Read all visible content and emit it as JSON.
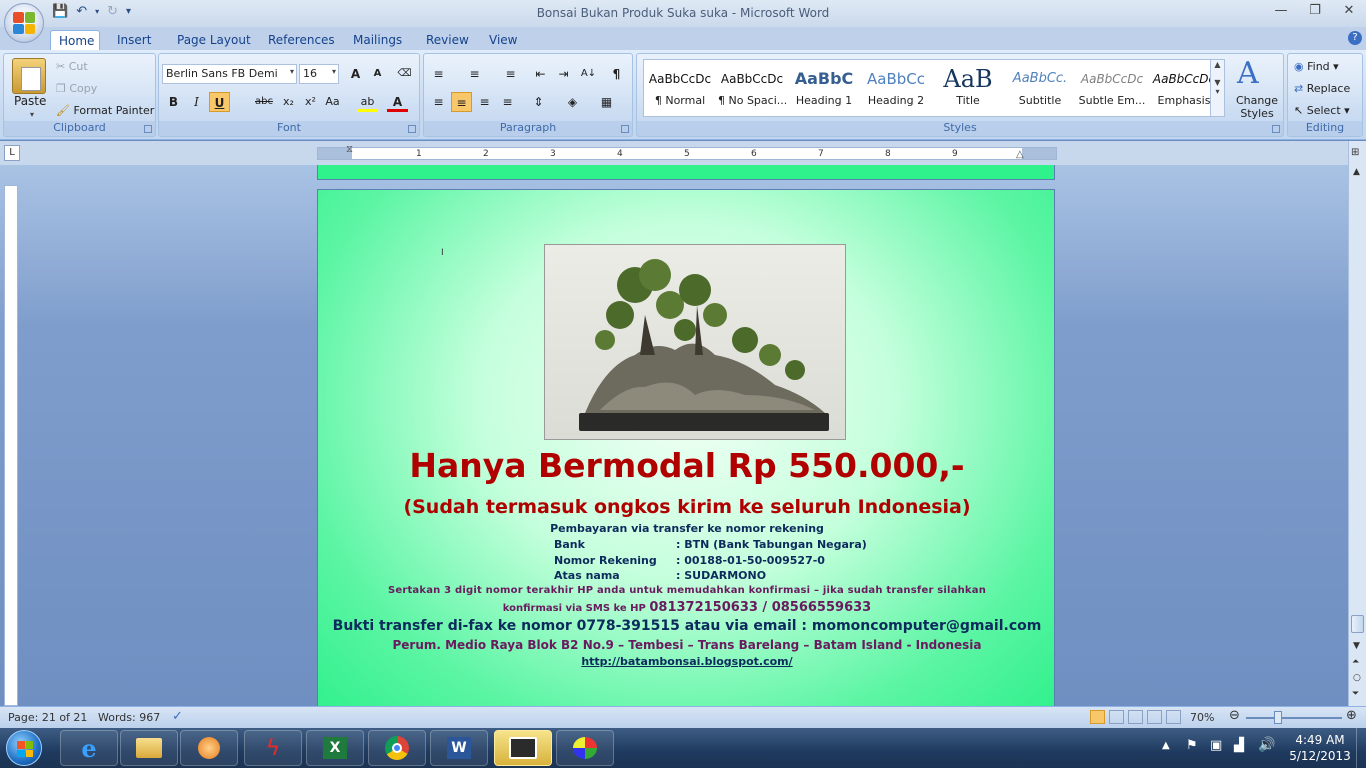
{
  "titlebar": {
    "title": "Bonsai Bukan Produk Suka suka - Microsoft Word",
    "qat_icons": [
      "save-icon",
      "undo-icon",
      "redo-icon",
      "customize-icon"
    ]
  },
  "tabs": [
    "Home",
    "Insert",
    "Page Layout",
    "References",
    "Mailings",
    "Review",
    "View"
  ],
  "clipboard": {
    "paste": "Paste",
    "cut": "Cut",
    "copy": "Copy",
    "format_painter": "Format Painter",
    "label": "Clipboard"
  },
  "font": {
    "name": "Berlin Sans FB Demi",
    "size": "16",
    "label": "Font",
    "grow": "A",
    "shrink": "A",
    "bold": "B",
    "italic": "I",
    "underline": "U",
    "strike": "abc",
    "sub": "x₂",
    "sup": "x²",
    "case": "Aa",
    "color": "A"
  },
  "paragraph": {
    "label": "Paragraph"
  },
  "styles": {
    "label": "Styles",
    "items": [
      {
        "preview": "AaBbCcDc",
        "name": "¶ Normal"
      },
      {
        "preview": "AaBbCcDc",
        "name": "¶ No Spaci..."
      },
      {
        "preview": "AaBbC",
        "name": "Heading 1"
      },
      {
        "preview": "AaBbCc",
        "name": "Heading 2"
      },
      {
        "preview": "AaB",
        "name": "Title"
      },
      {
        "preview": "AaBbCc.",
        "name": "Subtitle"
      },
      {
        "preview": "AaBbCcDc",
        "name": "Subtle Em..."
      },
      {
        "preview": "AaBbCcDc",
        "name": "Emphasis"
      }
    ],
    "change": "Change Styles"
  },
  "editing": {
    "find": "Find",
    "replace": "Replace",
    "select": "Select",
    "label": "Editing"
  },
  "ruler": {
    "numbers": [
      "1",
      "2",
      "3",
      "4",
      "5",
      "6",
      "7",
      "8",
      "9"
    ]
  },
  "document": {
    "cursor_mark": "I",
    "headline": "Hanya Bermodal Rp 550.000,-",
    "subheadline": "(Sudah termasuk ongkos kirim ke seluruh Indonesia)",
    "payment_intro": "Pembayaran via transfer ke nomor rekening",
    "details": [
      {
        "k": "Bank",
        "v": ": BTN (Bank Tabungan  Negara)"
      },
      {
        "k": "Nomor Rekening",
        "v": ": 00188-01-50-009527-0"
      },
      {
        "k": "Atas nama",
        "v": ": SUDARMONO"
      }
    ],
    "note1": "Sertakan 3 digit nomor terakhir HP anda untuk memudahkan  konfirmasi – jika sudah transfer silahkan",
    "note2_prefix": "konfirmasi via SMS ke HP ",
    "note2_phones": "081372150633 / 08566559633",
    "fax_line": "Bukti transfer di-fax ke nomor 0778-391515 atau via email : momoncomputer@gmail.com",
    "address": "Perum. Medio Raya Blok B2 No.9 – Tembesi – Trans Barelang – Batam Island - Indonesia",
    "url": "http://batambonsai.blogspot.com/"
  },
  "status": {
    "page": "Page: 21 of 21",
    "words": "Words: 967",
    "zoom": "70%"
  },
  "taskbar": {
    "time": "4:49 AM",
    "date": "5/12/2013"
  },
  "colors": {
    "headline": "#b00000",
    "page_green": "#2ff08b",
    "dark_text": "#0d2a5c",
    "purple_text": "#6a1b5f"
  }
}
